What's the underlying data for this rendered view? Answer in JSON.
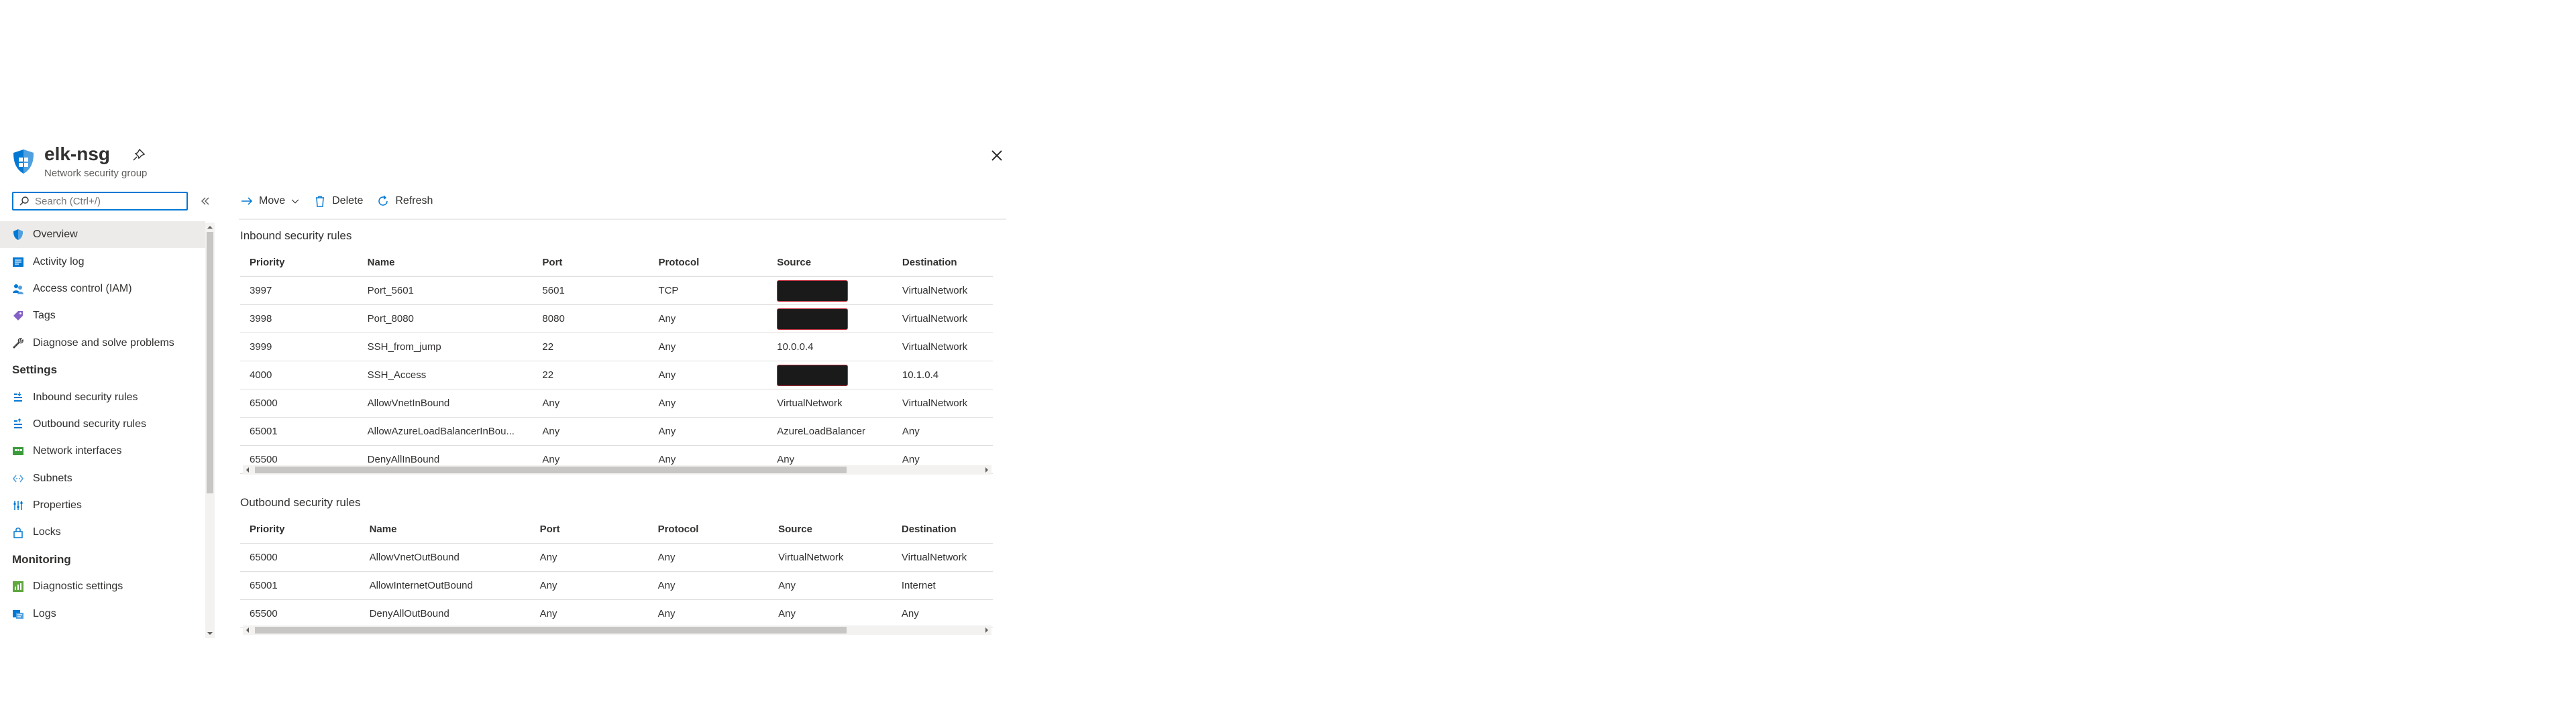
{
  "header": {
    "title": "elk-nsg",
    "subtitle": "Network security group"
  },
  "search": {
    "placeholder": "Search (Ctrl+/)"
  },
  "sidebar": {
    "items": [
      {
        "label": "Overview",
        "icon": "shield-icon",
        "active": true
      },
      {
        "label": "Activity log",
        "icon": "activity-log-icon"
      },
      {
        "label": "Access control (IAM)",
        "icon": "people-icon"
      },
      {
        "label": "Tags",
        "icon": "tag-icon"
      },
      {
        "label": "Diagnose and solve problems",
        "icon": "wrench-icon"
      }
    ],
    "settings_title": "Settings",
    "settings": [
      {
        "label": "Inbound security rules",
        "icon": "inbound-rules-icon"
      },
      {
        "label": "Outbound security rules",
        "icon": "outbound-rules-icon"
      },
      {
        "label": "Network interfaces",
        "icon": "network-interface-icon"
      },
      {
        "label": "Subnets",
        "icon": "subnet-icon"
      },
      {
        "label": "Properties",
        "icon": "properties-icon"
      },
      {
        "label": "Locks",
        "icon": "lock-icon"
      }
    ],
    "monitoring_title": "Monitoring",
    "monitoring": [
      {
        "label": "Diagnostic settings",
        "icon": "diagnostic-settings-icon"
      },
      {
        "label": "Logs",
        "icon": "logs-icon"
      }
    ]
  },
  "toolbar": {
    "move": "Move",
    "delete": "Delete",
    "refresh": "Refresh"
  },
  "inbound": {
    "title": "Inbound security rules",
    "columns": [
      "Priority",
      "Name",
      "Port",
      "Protocol",
      "Source",
      "Destination"
    ],
    "rows": [
      [
        "3997",
        "Port_5601",
        "5601",
        "TCP",
        "",
        "VirtualNetwork"
      ],
      [
        "3998",
        "Port_8080",
        "8080",
        "Any",
        "",
        "VirtualNetwork"
      ],
      [
        "3999",
        "SSH_from_jump",
        "22",
        "Any",
        "10.0.0.4",
        "VirtualNetwork"
      ],
      [
        "4000",
        "SSH_Access",
        "22",
        "Any",
        "",
        "10.1.0.4"
      ],
      [
        "65000",
        "AllowVnetInBound",
        "Any",
        "Any",
        "VirtualNetwork",
        "VirtualNetwork"
      ],
      [
        "65001",
        "AllowAzureLoadBalancerInBou...",
        "Any",
        "Any",
        "AzureLoadBalancer",
        "Any"
      ],
      [
        "65500",
        "DenyAllInBound",
        "Any",
        "Any",
        "Any",
        "Any"
      ]
    ]
  },
  "outbound": {
    "title": "Outbound security rules",
    "columns": [
      "Priority",
      "Name",
      "Port",
      "Protocol",
      "Source",
      "Destination"
    ],
    "rows": [
      [
        "65000",
        "AllowVnetOutBound",
        "Any",
        "Any",
        "VirtualNetwork",
        "VirtualNetwork"
      ],
      [
        "65001",
        "AllowInternetOutBound",
        "Any",
        "Any",
        "Any",
        "Internet"
      ],
      [
        "65500",
        "DenyAllOutBound",
        "Any",
        "Any",
        "Any",
        "Any"
      ]
    ]
  },
  "colors": {
    "accent": "#0078d4",
    "text": "#323130",
    "muted": "#605e5c",
    "active_bg": "#edebe9"
  }
}
